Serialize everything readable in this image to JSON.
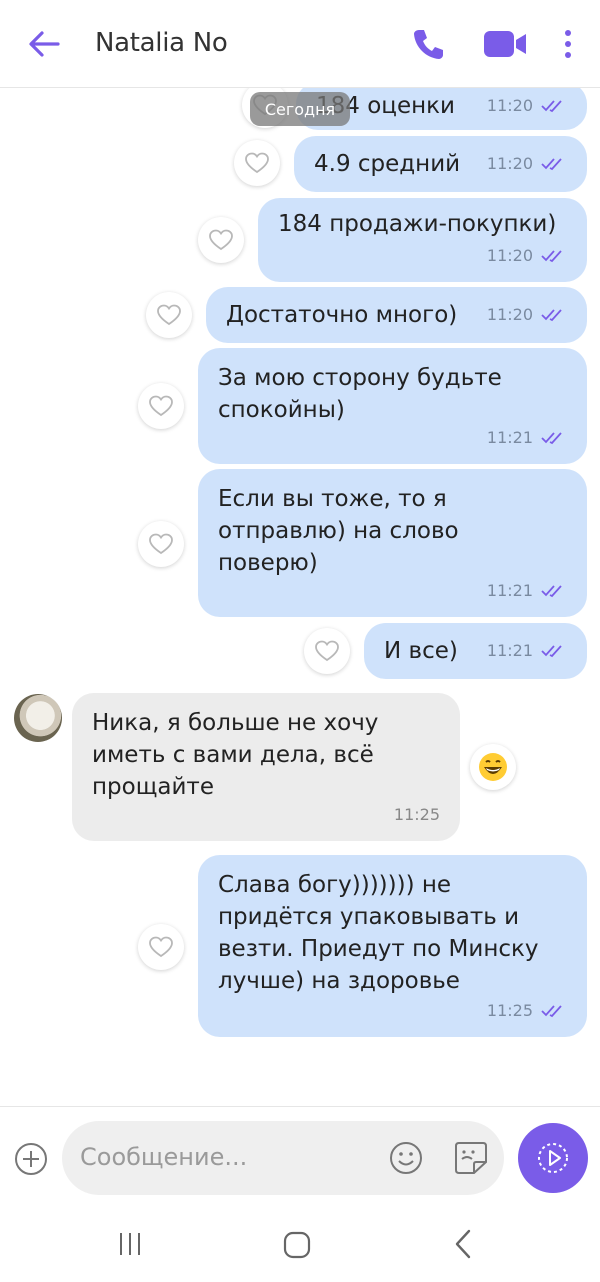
{
  "header": {
    "title": "Natalia No",
    "accent_color": "#7a5ce8",
    "icons": [
      "back-arrow-icon",
      "phone-icon",
      "video-camera-icon",
      "more-vertical-icon"
    ]
  },
  "chat": {
    "date_pill": "Сегодня",
    "messages": [
      {
        "dir": "out",
        "text": "184 оценки",
        "time": "11:20"
      },
      {
        "dir": "out",
        "text": "4.9 средний",
        "time": "11:20"
      },
      {
        "dir": "out",
        "text": "184 продажи-покупки)",
        "time": "11:20"
      },
      {
        "dir": "out",
        "text": "Достаточно много)",
        "time": "11:20"
      },
      {
        "dir": "out",
        "text": "За мою сторону будьте\nспокойны)",
        "time": "11:21"
      },
      {
        "dir": "out",
        "text": "Если вы тоже, то я\nотправлю)  на слово\nповерю)",
        "time": "11:21"
      },
      {
        "dir": "out",
        "text": "И все)",
        "time": "11:21"
      },
      {
        "dir": "in",
        "text": "Ника, я больше не хочу\nиметь с вами дела, всё\nпрощайте",
        "time": "11:25"
      },
      {
        "dir": "out",
        "text": "Слава богу))))))) не\nпридётся упаковывать и\nвезти. Приедут по Минску\nлучше) на здоровье",
        "time": "11:25"
      }
    ],
    "outgoing_bubble_color": "#cfe2fb",
    "incoming_bubble_color": "#ececec",
    "reaction_emoji_icon": "grinning-face-icon"
  },
  "composer": {
    "placeholder": "Сообщение...",
    "icons": [
      "plus-circle-icon",
      "smiley-icon",
      "sticker-icon",
      "send-icon"
    ]
  },
  "navbar": {
    "icons": [
      "recents-icon",
      "home-icon",
      "back-icon"
    ]
  }
}
